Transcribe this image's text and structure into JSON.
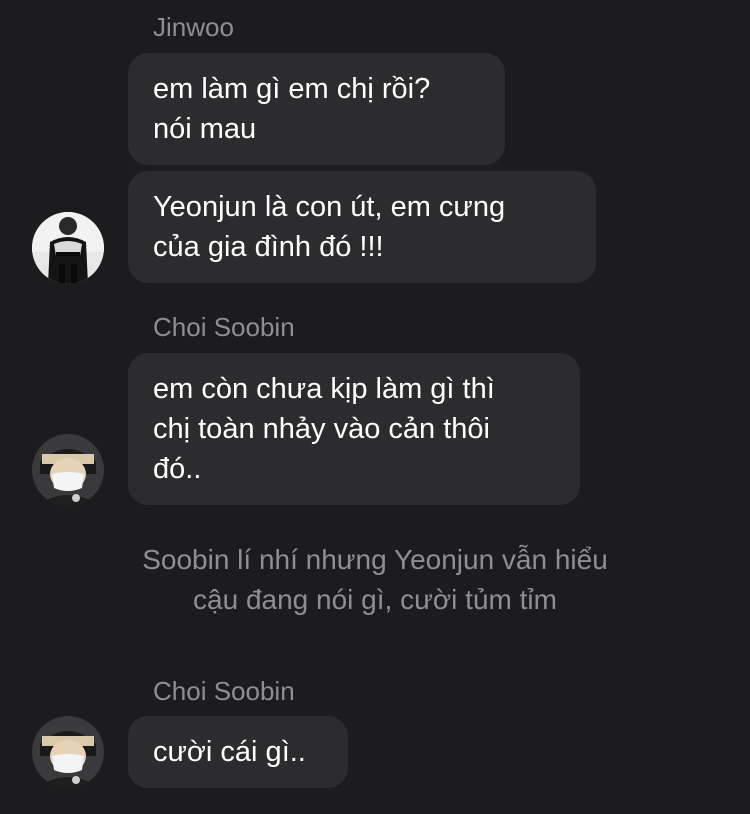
{
  "messages": [
    {
      "sender": "Jinwoo",
      "bubbles": [
        {
          "lines": [
            "em làm gì em chị rồi?",
            "nói mau"
          ]
        },
        {
          "lines": [
            "Yeonjun là con út, em cưng",
            "của gia đình đó !!!"
          ]
        }
      ],
      "avatar_icon": "avatar-jinwoo-icon"
    },
    {
      "sender": "Choi Soobin",
      "bubbles": [
        {
          "lines": [
            "em còn chưa kịp làm gì thì",
            "chị toàn nhảy vào cản thôi",
            "đó.."
          ]
        }
      ],
      "avatar_icon": "avatar-soobin-icon"
    },
    {
      "sender": "Choi Soobin",
      "bubbles": [
        {
          "lines": [
            "cười cái gì.."
          ]
        }
      ],
      "avatar_icon": "avatar-soobin-icon"
    }
  ],
  "narration": {
    "lines": [
      "Soobin lí nhí nhưng Yeonjun vẫn hiểu",
      "cậu đang nói gì, cười tủm tỉm"
    ]
  },
  "colors": {
    "background": "#1c1c1e",
    "bubble": "#2c2c2e",
    "sender_name": "#8e8e93",
    "text": "#ffffff"
  }
}
